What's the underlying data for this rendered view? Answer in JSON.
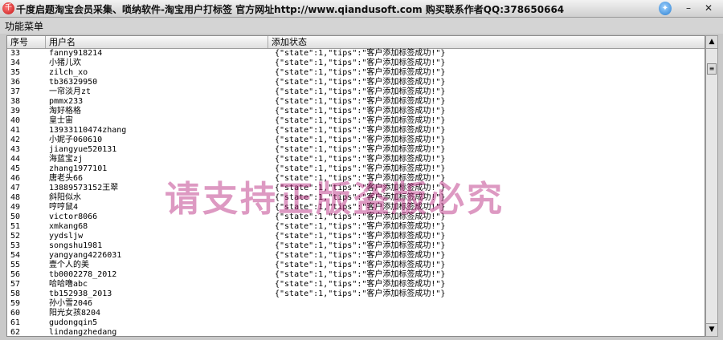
{
  "window": {
    "title": "千度启题淘宝会员采集、唢纳软件-淘宝用户打标签 官方网址http://www.qiandusoft.com 购买联系作者QQ:378650664",
    "skin_icon": "skin-icon",
    "min_label": "–",
    "close_label": "✕"
  },
  "menu": {
    "function_menu": "功能菜单"
  },
  "table": {
    "columns": {
      "seq": "序号",
      "user": "用户名",
      "status": "添加状态"
    },
    "rows": [
      {
        "seq": "33",
        "user": "fanny918214",
        "status": "{\"state\":1,\"tips\":\"客户添加标签成功!\"}"
      },
      {
        "seq": "34",
        "user": "小猪儿欢",
        "status": "{\"state\":1,\"tips\":\"客户添加标签成功!\"}"
      },
      {
        "seq": "35",
        "user": "zilch_xo",
        "status": "{\"state\":1,\"tips\":\"客户添加标签成功!\"}"
      },
      {
        "seq": "36",
        "user": "tb36329950",
        "status": "{\"state\":1,\"tips\":\"客户添加标签成功!\"}"
      },
      {
        "seq": "37",
        "user": "一帘淡月zt",
        "status": "{\"state\":1,\"tips\":\"客户添加标签成功!\"}"
      },
      {
        "seq": "38",
        "user": "pmmx233",
        "status": "{\"state\":1,\"tips\":\"客户添加标签成功!\"}"
      },
      {
        "seq": "39",
        "user": "淘好格格",
        "status": "{\"state\":1,\"tips\":\"客户添加标签成功!\"}"
      },
      {
        "seq": "40",
        "user": "皇士宙",
        "status": "{\"state\":1,\"tips\":\"客户添加标签成功!\"}"
      },
      {
        "seq": "41",
        "user": "13933110474zhang",
        "status": "{\"state\":1,\"tips\":\"客户添加标签成功!\"}"
      },
      {
        "seq": "42",
        "user": "小妮子060610",
        "status": "{\"state\":1,\"tips\":\"客户添加标签成功!\"}"
      },
      {
        "seq": "43",
        "user": "jiangyue520131",
        "status": "{\"state\":1,\"tips\":\"客户添加标签成功!\"}"
      },
      {
        "seq": "44",
        "user": "海蓝宝zj",
        "status": "{\"state\":1,\"tips\":\"客户添加标签成功!\"}"
      },
      {
        "seq": "45",
        "user": "zhang1977101",
        "status": "{\"state\":1,\"tips\":\"客户添加标签成功!\"}"
      },
      {
        "seq": "46",
        "user": "唐老头66",
        "status": "{\"state\":1,\"tips\":\"客户添加标签成功!\"}"
      },
      {
        "seq": "47",
        "user": "13889573152王翠",
        "status": "{\"state\":1,\"tips\":\"客户添加标签成功!\"}"
      },
      {
        "seq": "48",
        "user": "斜阳似水",
        "status": "{\"state\":1,\"tips\":\"客户添加标签成功!\"}"
      },
      {
        "seq": "49",
        "user": "哼哼鼠4",
        "status": "{\"state\":1,\"tips\":\"客户添加标签成功!\"}"
      },
      {
        "seq": "50",
        "user": "victor8066",
        "status": "{\"state\":1,\"tips\":\"客户添加标签成功!\"}"
      },
      {
        "seq": "51",
        "user": "xmkang68",
        "status": "{\"state\":1,\"tips\":\"客户添加标签成功!\"}"
      },
      {
        "seq": "52",
        "user": "yydsljw",
        "status": "{\"state\":1,\"tips\":\"客户添加标签成功!\"}"
      },
      {
        "seq": "53",
        "user": "songshu1981",
        "status": "{\"state\":1,\"tips\":\"客户添加标签成功!\"}"
      },
      {
        "seq": "54",
        "user": "yangyang4226031",
        "status": "{\"state\":1,\"tips\":\"客户添加标签成功!\"}"
      },
      {
        "seq": "55",
        "user": "壹个人的美",
        "status": "{\"state\":1,\"tips\":\"客户添加标签成功!\"}"
      },
      {
        "seq": "56",
        "user": "tb0002278_2012",
        "status": "{\"state\":1,\"tips\":\"客户添加标签成功!\"}"
      },
      {
        "seq": "57",
        "user": "哈哈噜abc",
        "status": "{\"state\":1,\"tips\":\"客户添加标签成功!\"}"
      },
      {
        "seq": "58",
        "user": "tb152938_2013",
        "status": "{\"state\":1,\"tips\":\"客户添加标签成功!\"}"
      },
      {
        "seq": "59",
        "user": "孙小雪2046",
        "status": ""
      },
      {
        "seq": "60",
        "user": "阳光女孩8204",
        "status": ""
      },
      {
        "seq": "61",
        "user": "gudongqin5",
        "status": ""
      },
      {
        "seq": "62",
        "user": "lindangzhedang",
        "status": ""
      }
    ]
  },
  "watermark": "请支持正版盗版必究",
  "scrollbar": {
    "up_icon": "▲",
    "down_icon": "▼",
    "thumb_icon": "≡"
  }
}
